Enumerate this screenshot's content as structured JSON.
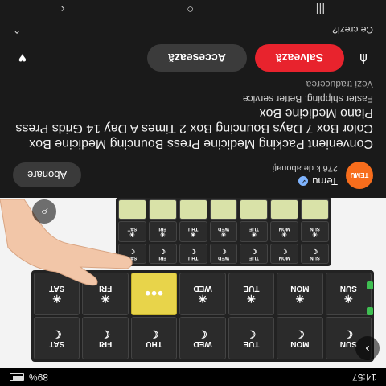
{
  "status_bar": {
    "time": "14:57",
    "battery": "89%",
    "battery_icon": "battery-icon"
  },
  "product": {
    "organizer_front": {
      "top_row": [
        "SUN",
        "MON",
        "TUE",
        "WED",
        "THU",
        "FRI",
        "SAT"
      ],
      "bottom_row": [
        "SUN",
        "MON",
        "TUE",
        "WED",
        "THU",
        "FRI",
        "SAT"
      ]
    },
    "organizer_back": {
      "top_row": [
        "SUN",
        "MON",
        "TUE",
        "WED",
        "THU",
        "FRI",
        "SAT"
      ],
      "bottom_row": [
        "SUN",
        "MON",
        "TUE",
        "WED",
        "THU",
        "FRI",
        "SAT"
      ]
    }
  },
  "seller": {
    "logo_text": "TEMU",
    "name": "Temu",
    "subscribers": "276 k de abonați",
    "subscribe_label": "Abonare"
  },
  "title": "Convenient Packing Medicine Press Bouncing Medicine Box Color Box 7 Days Bouncing Box 2 Times A Day 14 Grids Press Piano Medicine Box",
  "subtitle": "Faster shipping. Better service",
  "translate_link": "Vezi traducerea",
  "actions": {
    "access_label": "Accesează",
    "save_label": "Salvează"
  },
  "footer": {
    "question": "Ce crezi?"
  },
  "colors": {
    "save_button": "#e8232d",
    "temu_brand": "#f76d1c"
  }
}
